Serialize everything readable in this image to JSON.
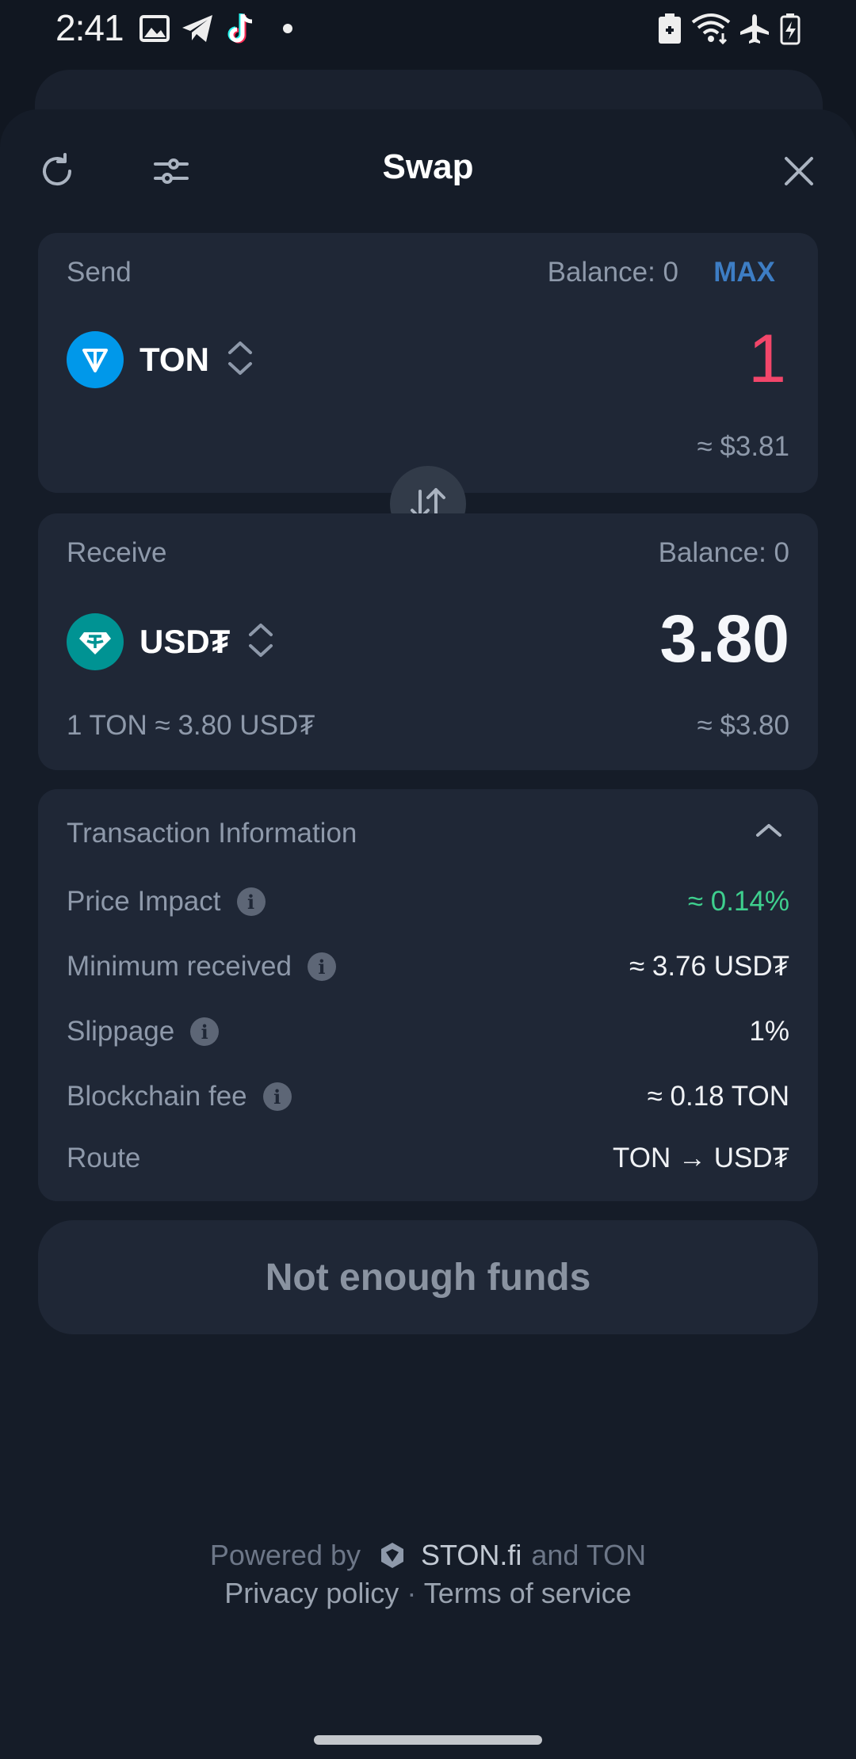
{
  "status_bar": {
    "time": "2:41",
    "notification_icons": [
      "gallery-icon",
      "telegram-icon",
      "tiktok-icon",
      "dot-icon"
    ],
    "system_icons": [
      "battery-saver-icon",
      "wifi-icon",
      "airplane-icon",
      "battery-icon"
    ]
  },
  "header": {
    "title": "Swap",
    "refresh_icon": "refresh-icon",
    "settings_icon": "sliders-icon",
    "close_icon": "close-icon"
  },
  "send": {
    "label": "Send",
    "balance": "Balance: 0",
    "max_label": "MAX",
    "token": "TON",
    "amount": "1",
    "usd_value": "≈ $3.81"
  },
  "receive": {
    "label": "Receive",
    "balance": "Balance: 0",
    "token": "USD₮",
    "amount": "3.80",
    "rate": "1 TON ≈ 3.80 USD₮",
    "usd_value": "≈ $3.80"
  },
  "transaction": {
    "title": "Transaction Information",
    "rows": [
      {
        "label": "Price Impact",
        "value": "≈ 0.14%"
      },
      {
        "label": "Minimum received",
        "value": "≈ 3.76 USD₮"
      },
      {
        "label": "Slippage",
        "value": "1%"
      },
      {
        "label": "Blockchain fee",
        "value": "≈ 0.18 TON"
      },
      {
        "label": "Route",
        "value": "TON → USD₮"
      }
    ]
  },
  "cta_label": "Not enough funds",
  "footer": {
    "powered_by": "Powered by",
    "provider": "STON.fi",
    "and_ton": "and TON",
    "privacy": "Privacy policy",
    "separator": "·",
    "terms": "Terms of service"
  },
  "colors": {
    "background": "#111721",
    "card": "#1f2736",
    "accent_blue": "#3d7dc4",
    "amount_red": "#f2466a",
    "impact_green": "#3ecf8e",
    "ton_blue": "#0098ea",
    "usdt_teal": "#009393"
  }
}
